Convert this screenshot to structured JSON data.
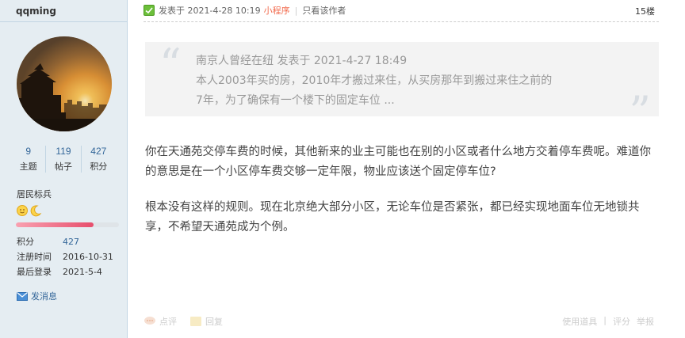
{
  "user": {
    "name": "qqming",
    "stats": [
      {
        "value": "9",
        "label": "主题"
      },
      {
        "value": "119",
        "label": "帖子"
      },
      {
        "value": "427",
        "label": "积分"
      }
    ],
    "rank_title": "居民标兵",
    "rank_progress": 0.75,
    "info": [
      {
        "key": "积分",
        "value": "427"
      },
      {
        "key": "注册时间",
        "value": "2016-10-31"
      },
      {
        "key": "最后登录",
        "value": "2021-5-4"
      }
    ],
    "send_message_label": "发消息"
  },
  "post": {
    "posted_label": "发表于 2021-4-28 10:19",
    "miniapp_label": "小程序",
    "only_author_label": "只看该作者",
    "floor": "15楼",
    "quote": {
      "header": "南京人曾经在纽 发表于 2021-4-27 18:49",
      "line1": "本人2003年买的房，2010年才搬过来住，从买房那年到搬过来住之前的",
      "line2": "7年，为了确保有一个楼下的固定车位 ..."
    },
    "paragraphs": [
      "你在天通苑交停车费的时候，其他新来的业主可能也在别的小区或者什么地方交着停车费呢。难道你的意思是在一个小区停车费交够一定年限，物业应该送个固定停车位?",
      "根本没有这样的规则。现在北京绝大部分小区，无论车位是否紧张，都已经实现地面车位无地锁共享，不希望天通苑成为个例。"
    ]
  },
  "footer": {
    "comment_label": "点评",
    "reply_label": "回复",
    "tools_label": "使用道具",
    "rate_label": "评分",
    "report_label": "举报"
  },
  "colors": {
    "sidebar_bg": "#e5edf2",
    "link": "#336699",
    "miniapp": "#f26c4f"
  }
}
